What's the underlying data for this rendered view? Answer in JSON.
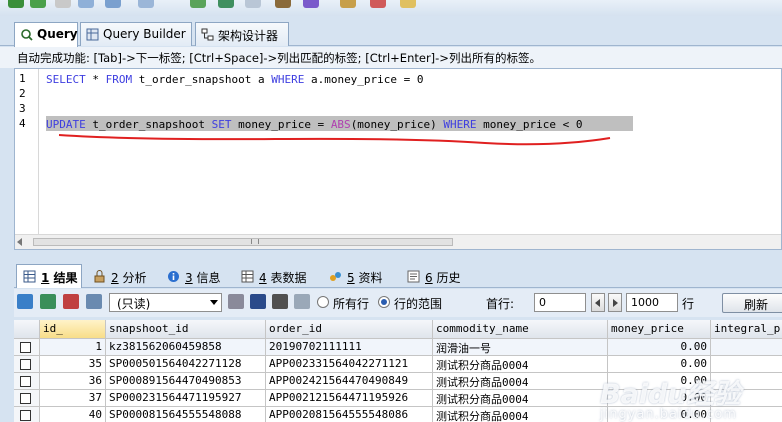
{
  "query_tabs": [
    {
      "label": "Query",
      "icon": "query-icon",
      "active": true
    },
    {
      "label": "Query Builder",
      "icon": "query-builder-icon",
      "active": false
    },
    {
      "label": "架构设计器",
      "icon": "schema-designer-icon",
      "active": false
    }
  ],
  "hint": "自动完成功能: [Tab]->下一标签; [Ctrl+Space]->列出匹配的标签; [Ctrl+Enter]->列出所有的标签。",
  "editor": {
    "line_numbers": [
      "1",
      "2",
      "3",
      "4"
    ],
    "line1": {
      "kw_select": "SELECT",
      "star": " * ",
      "kw_from": "FROM",
      "table": " t_order_snapshoot a ",
      "kw_where": "WHERE",
      "cond": " a.money_price = 0"
    },
    "line4": {
      "kw_update": "UPDATE",
      "table": " t_order_snapshoot ",
      "kw_set": "SET",
      "assign": " money_price = ",
      "fn_abs": "ABS",
      "arg": "(money_price) ",
      "kw_where": "WHERE",
      "cond": " money_price < 0"
    },
    "annotation_color": "#e02020"
  },
  "result_tabs": [
    {
      "num": "1",
      "label": "结果",
      "icon": "result-grid-icon",
      "active": true
    },
    {
      "num": "2",
      "label": "分析",
      "icon": "profile-icon",
      "active": false
    },
    {
      "num": "3",
      "label": "信息",
      "icon": "info-icon",
      "active": false
    },
    {
      "num": "4",
      "label": "表数据",
      "icon": "table-data-icon",
      "active": false
    },
    {
      "num": "5",
      "label": "资料",
      "icon": "objects-icon",
      "active": false
    },
    {
      "num": "6",
      "label": "历史",
      "icon": "history-icon",
      "active": false
    }
  ],
  "results_toolbar": {
    "mode_select": "(只读)",
    "radio_all": "所有行",
    "radio_range": "行的范围",
    "first_row_label": "首行:",
    "first_row_value": "0",
    "row_count_value": "1000",
    "rows_label": "行",
    "refresh_label": "刷新"
  },
  "grid": {
    "columns": [
      "id_",
      "snapshoot_id",
      "order_id",
      "commodity_name",
      "money_price",
      "integral_p"
    ],
    "rows": [
      {
        "id": "1",
        "snapshoot_id": "kz381562060459858",
        "order_id": "20190702111111",
        "commodity_name": "润滑油一号",
        "money_price": "0.00"
      },
      {
        "id": "35",
        "snapshoot_id": "SP000501564042271128",
        "order_id": "APP002331564042271121",
        "commodity_name": "测试积分商品0004",
        "money_price": "0.00"
      },
      {
        "id": "36",
        "snapshoot_id": "SP000891564470490853",
        "order_id": "APP002421564470490849",
        "commodity_name": "测试积分商品0004",
        "money_price": "0.00"
      },
      {
        "id": "37",
        "snapshoot_id": "SP000231564471195927",
        "order_id": "APP002121564471195926",
        "commodity_name": "测试积分商品0004",
        "money_price": "0.00"
      },
      {
        "id": "40",
        "snapshoot_id": "SP000081564555548088",
        "order_id": "APP002081564555548086",
        "commodity_name": "测试积分商品0004",
        "money_price": "0.00"
      }
    ]
  },
  "watermark": {
    "brand": "Baidu经验",
    "url": "jingyan.baidu.com"
  }
}
